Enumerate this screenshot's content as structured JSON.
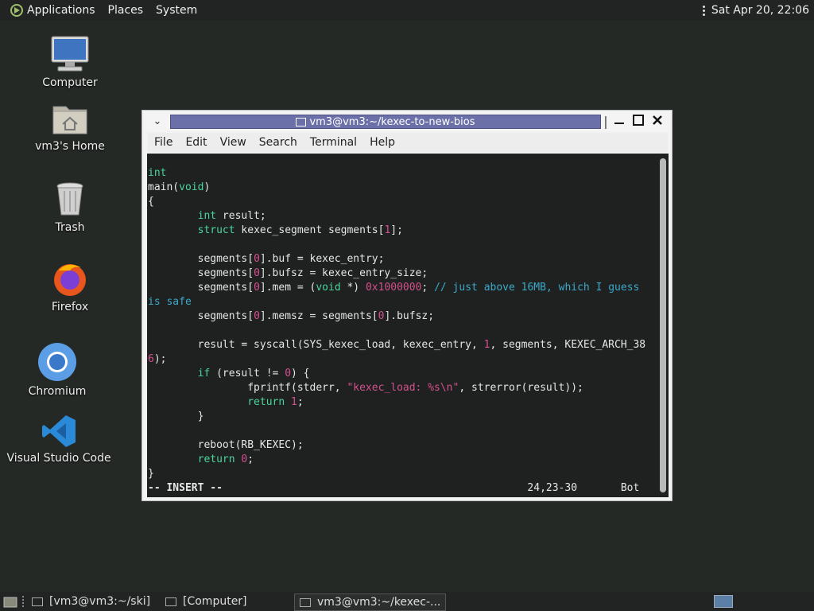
{
  "top_panel": {
    "menus": [
      "Applications",
      "Places",
      "System"
    ],
    "clock": "Sat Apr 20, 22:06"
  },
  "desktop_icons": [
    {
      "label": "Computer",
      "icon": "computer-icon"
    },
    {
      "label": "vm3's Home",
      "icon": "home-folder-icon"
    },
    {
      "label": "Trash",
      "icon": "trash-icon"
    },
    {
      "label": "Firefox",
      "icon": "firefox-icon"
    },
    {
      "label": "Chromium",
      "icon": "chromium-icon"
    },
    {
      "label": "Visual Studio Code",
      "icon": "vscode-icon"
    }
  ],
  "terminal": {
    "title": "vm3@vm3:~/kexec-to-new-bios",
    "menu": [
      "File",
      "Edit",
      "View",
      "Search",
      "Terminal",
      "Help"
    ],
    "code_lines": [
      "int",
      "main(void)",
      "{",
      "        int result;",
      "        struct kexec_segment segments[1];",
      "",
      "        segments[0].buf = kexec_entry;",
      "        segments[0].bufsz = kexec_entry_size;",
      "        segments[0].mem = (void *) 0x1000000; // just above 16MB, which I guess",
      "is safe",
      "        segments[0].memsz = segments[0].bufsz;",
      "",
      "        result = syscall(SYS_kexec_load, kexec_entry, 1, segments, KEXEC_ARCH_38",
      "6);",
      "        if (result != 0) {",
      "                fprintf(stderr, \"kexec_load: %s\\n\", strerror(result));",
      "                return 1;",
      "        }",
      "",
      "        reboot(RB_KEXEC);",
      "        return 0;",
      "}"
    ],
    "status_mode": "-- INSERT --",
    "status_pos": "24,23-30",
    "status_scroll": "Bot"
  },
  "taskbar": {
    "tasks": [
      "[vm3@vm3:~/ski]",
      "[Computer]",
      "vm3@vm3:~/kexec-..."
    ]
  },
  "colors": {
    "keyword": "#4ad59d",
    "number_string": "#d4508e",
    "comment": "#3ca9c9",
    "title_bar": "#6c70a8"
  }
}
